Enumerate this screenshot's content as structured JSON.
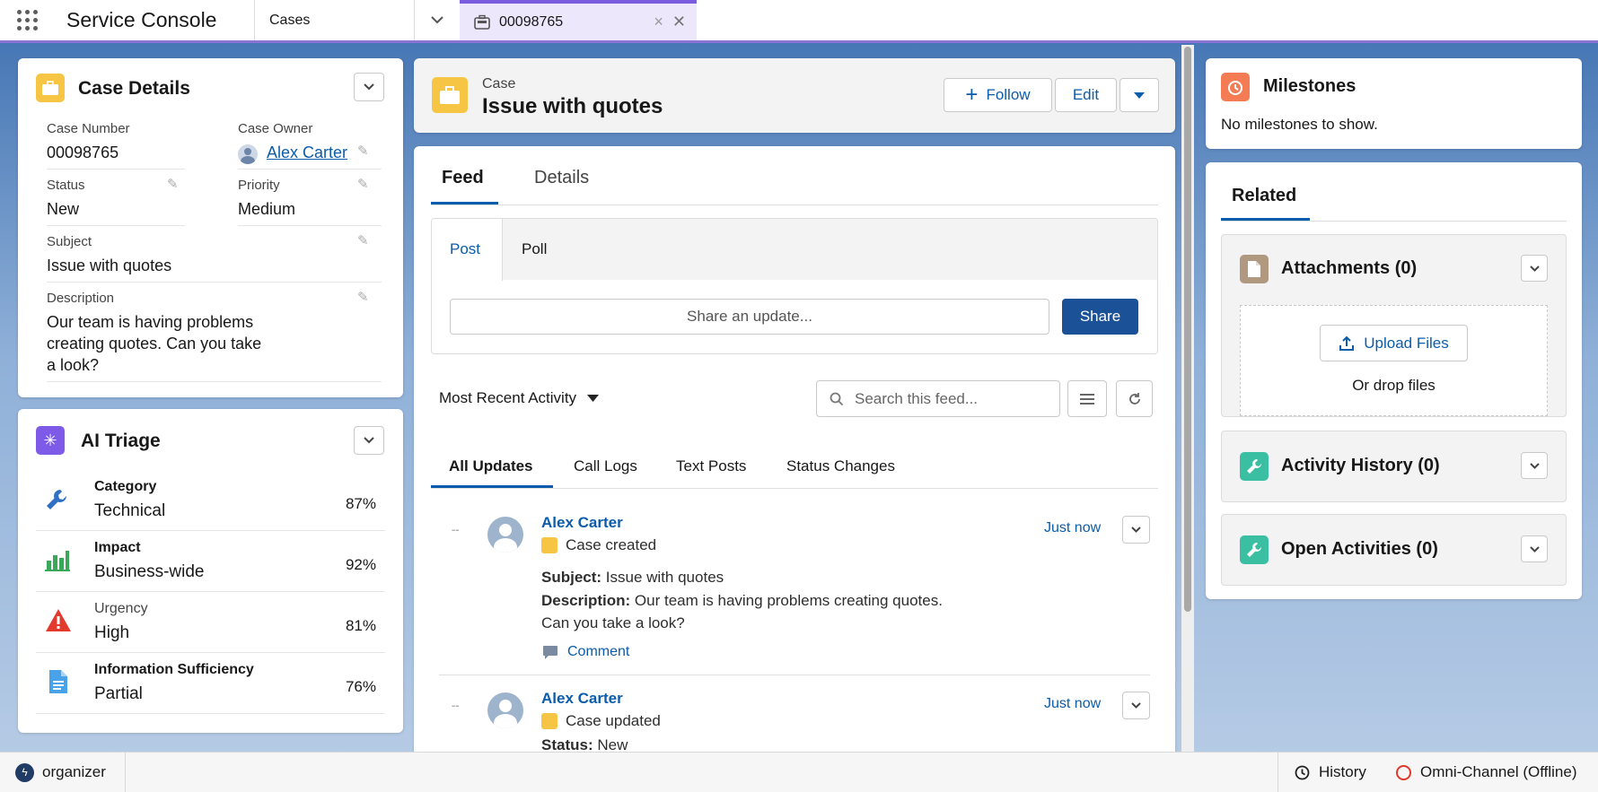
{
  "app": {
    "name": "Service Console",
    "nav_tab": "Cases",
    "workspace_tab": "00098765"
  },
  "case_details": {
    "title": "Case Details",
    "fields": {
      "case_number_label": "Case Number",
      "case_number": "00098765",
      "case_owner_label": "Case Owner",
      "case_owner": "Alex Carter",
      "status_label": "Status",
      "status": "New",
      "priority_label": "Priority",
      "priority": "Medium",
      "subject_label": "Subject",
      "subject": "Issue with quotes",
      "description_label": "Description",
      "description_lines": [
        "Our team is having problems",
        "creating quotes. Can you take",
        "a look?"
      ]
    }
  },
  "ai_triage": {
    "title": "AI Triage",
    "items": [
      {
        "label": "Category",
        "value": "Technical",
        "pct": "87%",
        "icon": "wrench-icon",
        "bold": true
      },
      {
        "label": "Impact",
        "value": "Business-wide",
        "pct": "92%",
        "icon": "bar-chart-icon",
        "bold": true
      },
      {
        "label": "Urgency",
        "value": "High",
        "pct": "81%",
        "icon": "warning-icon",
        "bold": false
      },
      {
        "label": "Information Sufficiency",
        "value": "Partial",
        "pct": "76%",
        "icon": "document-icon",
        "bold": true
      }
    ]
  },
  "case_header": {
    "object_label": "Case",
    "title": "Issue with quotes",
    "follow": "Follow",
    "edit": "Edit"
  },
  "feed": {
    "tabs": [
      "Feed",
      "Details"
    ],
    "publisher_tabs": [
      "Post",
      "Poll"
    ],
    "share_placeholder": "Share an update...",
    "share_button": "Share",
    "sort_label": "Most Recent Activity",
    "search_placeholder": "Search this feed...",
    "filter_tabs": [
      "All Updates",
      "Call Logs",
      "Text Posts",
      "Status Changes"
    ],
    "items": [
      {
        "author": "Alex Carter",
        "action": "Case created",
        "time": "Just now",
        "subject_label": "Subject:",
        "subject": "Issue with quotes",
        "description_label": "Description:",
        "description_line1": "Our team is having problems creating quotes.",
        "description_line2": "Can you take a look?",
        "comment": "Comment"
      },
      {
        "author": "Alex Carter",
        "action": "Case updated",
        "time": "Just now",
        "status_label": "Status:",
        "status": "New"
      }
    ]
  },
  "milestones": {
    "title": "Milestones",
    "empty": "No milestones to show."
  },
  "related": {
    "tab": "Related",
    "attachments": "Attachments (0)",
    "upload": "Upload Files",
    "drop": "Or drop files",
    "activity_history": "Activity History (0)",
    "open_activities": "Open Activities (0)"
  },
  "footer": {
    "organizer": "organizer",
    "history": "History",
    "omni": "Omni-Channel (Offline)"
  },
  "colors": {
    "brand_blue": "#0b5cab",
    "case_yellow": "#f6c544",
    "workspace_purple": "#7b5ce0",
    "milestone_orange": "#f47c55",
    "teal": "#3bbfa3"
  }
}
